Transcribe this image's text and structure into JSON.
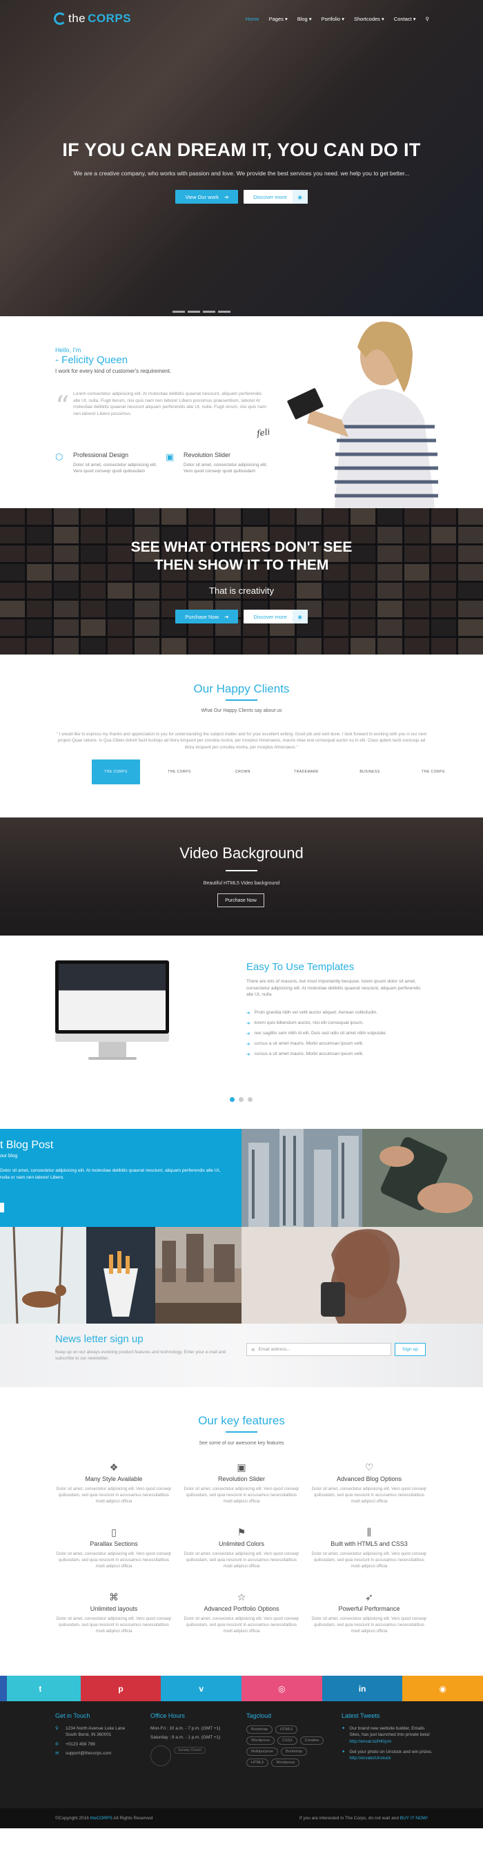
{
  "nav": {
    "logo_the": "the",
    "logo_corps": "CORPS",
    "items": [
      "Home",
      "Pages",
      "Blog",
      "Portfolio",
      "Shortcodes",
      "Contact"
    ]
  },
  "hero": {
    "title": "IF YOU CAN DREAM IT, YOU CAN DO IT",
    "subtitle": "We are a creative company, who works with passion and love. We provide the best services you need. we help you to get better...",
    "btn_primary": "View Our work",
    "btn_secondary": "Discover more"
  },
  "about": {
    "hello": "Hello, I'm",
    "name": "- Felicity Queen",
    "tagline": "I work for every kind of customer's requirement.",
    "quote": "Lorem consectetur adipisicing elit. At molestiae delibitis quaerat nesciunt, aliquam perferendis alle Ut, nulla. Fugit iterum, nisi quis nam nen labore! Libero possimus praesentium, laborel At molestiae delibitis quaerat nesciunt aliquam perferendis alle Ut, nulla. Fugit rerum, nisi quis nam nen labore! Libero possimus.",
    "signature": "felicity",
    "features": [
      {
        "title": "Professional Design",
        "text": "Dolor sit amet, consectetur adipisicing elit. Vero quod conseqr quoti quibusdam"
      },
      {
        "title": "Revolution Slider",
        "text": "Dolor sit amet, consectetur adipisicing elit. Vero quod conseqr quoti quibusdam"
      }
    ]
  },
  "others": {
    "title_line1": "SEE WHAT OTHERS DON'T SEE",
    "title_line2": "THEN SHOW IT TO THEM",
    "subtitle": "That is creativity",
    "btn_primary": "Purchase Now",
    "btn_secondary": "Discover more"
  },
  "clients": {
    "title": "Our Happy Clients",
    "subtitle": "What Our Happy Clients say about us",
    "testimonial": "\" I would like to express my thanks and appreciation to you for understanding the subject matter and for your excellent writing. Good job and well done. I look forward to working with you in our next project Quae ratione. Is Qua Cibeis dolorit facili lociloqu ad litora torquent per conubia nostra, per inceptos himenaeos, mauris vitae erat consequat auctor eu in elit. Class aptent taciti sociosqu ad litora torquent per conubia nostra, per inceptos himenaeos \"",
    "logos": [
      "THE CORPS",
      "THE CORPS",
      "CROWN",
      "TRADEMARK",
      "BUSINESS",
      "THE CORPS"
    ]
  },
  "video": {
    "title": "Video Background",
    "subtitle": "Beautiful HTML5 Video background",
    "button": "Purchase Now"
  },
  "templates": {
    "title": "Easy To Use Templates",
    "text": "There are lots of reasons, but most importantly because. lorem ipsum dolor sit amet, consectetur adipisicing elit. At molestiae delibitis quaerat nesciunt, aliquam perferendis alle Ut, nulla.",
    "list": [
      "Proin gravida nibh vel velit auctor aliquet. Aenean sollicitudin.",
      "lorem quis bibendum auctor, nisi elit consequat ipsum.",
      "nec sagittis sem nibh id elit. Duis sed odio sit amet nibh vulputate",
      "cursus a sit amet mauris. Morbi accumsan ipsum velit.",
      "cursus a sit amet mauris. Morbi accumsan ipsum velit."
    ]
  },
  "blog": {
    "title": "t Blog Post",
    "subtitle": "our blog",
    "text": "Dolor sit amet, consectetur adipisicing elit. At molestiae delibitis quaerat nesciunt, aliquam perferendis alle Ut, nulla ur nam nen labore! Libero."
  },
  "newsletter": {
    "title": "News letter sign up",
    "text": "Keep up on our always evolving product features and technology. Enter your e-mail and subscribe to our newsletter.",
    "placeholder": "Email address...",
    "button": "Sign up"
  },
  "features": {
    "title": "Our key features",
    "subtitle": "See some of our awesome key features",
    "desc": "Dolor sit amet, consectetur adipisicing elit. Vero quod conseqr quibusdam, sed quia nesciunt in accusamus necessitatibus modi adipisci officia",
    "items": [
      {
        "icon": "layers-icon",
        "glyph": "❖",
        "title": "Many Style Available"
      },
      {
        "icon": "image-icon",
        "glyph": "▣",
        "title": "Revolution Slider"
      },
      {
        "icon": "heart-icon",
        "glyph": "♡",
        "title": "Advanced Blog Options"
      },
      {
        "icon": "mobile-icon",
        "glyph": "▯",
        "title": "Parallax Sections"
      },
      {
        "icon": "flag-icon",
        "glyph": "⚑",
        "title": "Unlimited Colors"
      },
      {
        "icon": "sliders-icon",
        "glyph": "⫼",
        "title": "Built with HTML5 and CSS3"
      },
      {
        "icon": "paperclip-icon",
        "glyph": "⌘",
        "title": "Unlimited layouts"
      },
      {
        "icon": "star-icon",
        "glyph": "☆",
        "title": "Advanced Portfolio Options"
      },
      {
        "icon": "rocket-icon",
        "glyph": "➶",
        "title": "Powerful Performance"
      }
    ]
  },
  "social": [
    {
      "icon": "twitter-icon",
      "glyph": "t",
      "color": "#36c3d6"
    },
    {
      "icon": "pinterest-icon",
      "glyph": "p",
      "color": "#d2323e"
    },
    {
      "icon": "vimeo-icon",
      "glyph": "v",
      "color": "#1ea6d6"
    },
    {
      "icon": "dribbble-icon",
      "glyph": "◎",
      "color": "#e84f7d"
    },
    {
      "icon": "linkedin-icon",
      "glyph": "in",
      "color": "#1a7fb5"
    },
    {
      "icon": "rss-icon",
      "glyph": "◉",
      "color": "#f5a01a"
    }
  ],
  "footer": {
    "contact_title": "Get in Touch",
    "address1": "1234 North Avenue Luke Lane",
    "address2": "South Bend, IN 360001",
    "phone": "+0123 456 789",
    "email": "support@thecorps.com",
    "hours_title": "Office Hours",
    "hours1": "Mon-Fri : 10 a.m. - 7 p.m. (GMT +1)",
    "hours2": "Saturday : 9 a.m. - 1 p.m. (GMT +1)",
    "hours_note": "Sunday Closed",
    "tags_title": "Tagcloud",
    "tags": [
      "Bootstrap",
      "HTML5",
      "Wordpress",
      "CSS3",
      "Creative",
      "Multipurpose",
      "Bootstrap",
      "HTML5",
      "Wordpress"
    ],
    "tweets_title": "Latest Tweets",
    "tweet1": "Our brand new website builder, Emails Sites, has just launched into private beta!",
    "tweet1_link": "http://envat.to/HKIyzn",
    "tweet2": "Get your photo on Unstock and win prizes.",
    "tweet2_link": "http://envato/Unstock"
  },
  "bottom": {
    "copyright": "©Copyright 2016",
    "brand": "theCORPS",
    "rights": "All Rights Reserved",
    "cta": "If you are interested in The Corps, do not wait and",
    "cta_link": "BUY IT NOW!"
  },
  "colors": {
    "accent": "#2ab0e0",
    "dark_footer": "#1d1d1d"
  }
}
